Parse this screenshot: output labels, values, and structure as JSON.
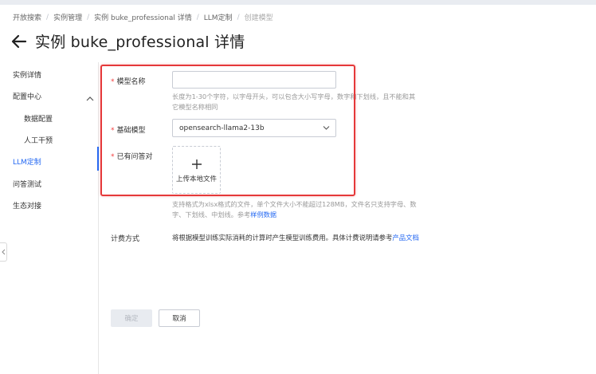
{
  "breadcrumb": [
    {
      "label": "开放搜索"
    },
    {
      "label": "实例管理"
    },
    {
      "label": "实例 buke_professional 详情"
    },
    {
      "label": "LLM定制"
    },
    {
      "label": "创建模型"
    }
  ],
  "page_title": "实例 buke_professional 详情",
  "sidebar": {
    "items": [
      {
        "label": "实例详情"
      },
      {
        "label": "配置中心"
      },
      {
        "label": "数据配置"
      },
      {
        "label": "人工干预"
      },
      {
        "label": "LLM定制"
      },
      {
        "label": "问答测试"
      },
      {
        "label": "生态对接"
      }
    ],
    "active_color": "#2468f2"
  },
  "form": {
    "required_mark": "*",
    "model_name": {
      "label": "模型名称",
      "value": "",
      "hint_line1": "长度为1-30个字符，以字母开头，可以包含大小写字母，数字和下划线，且不能和其",
      "hint_line2": "它模型名称相同"
    },
    "base_model": {
      "label": "基础模型",
      "value": "opensearch-llama2-13b"
    },
    "qa_pairs": {
      "label": "已有问答对",
      "upload_label": "上传本地文件",
      "hint_line1": "支持格式为xlsx格式的文件，单个文件大小不能超过128MB，文件名只支持字母、数",
      "hint_line2_prefix": "字、下划线、中划线。参考",
      "sample_link": "样例数据"
    },
    "billing": {
      "label": "计费方式",
      "text": "将根据模型训练实际消耗的计算时产生模型训练费用。具体计费说明请参考",
      "link": "产品文档"
    }
  },
  "buttons": {
    "confirm": "确定",
    "cancel": "取消"
  },
  "colors": {
    "accent": "#2468f2",
    "required": "#f33e3e",
    "highlight_frame": "#e5393a"
  }
}
